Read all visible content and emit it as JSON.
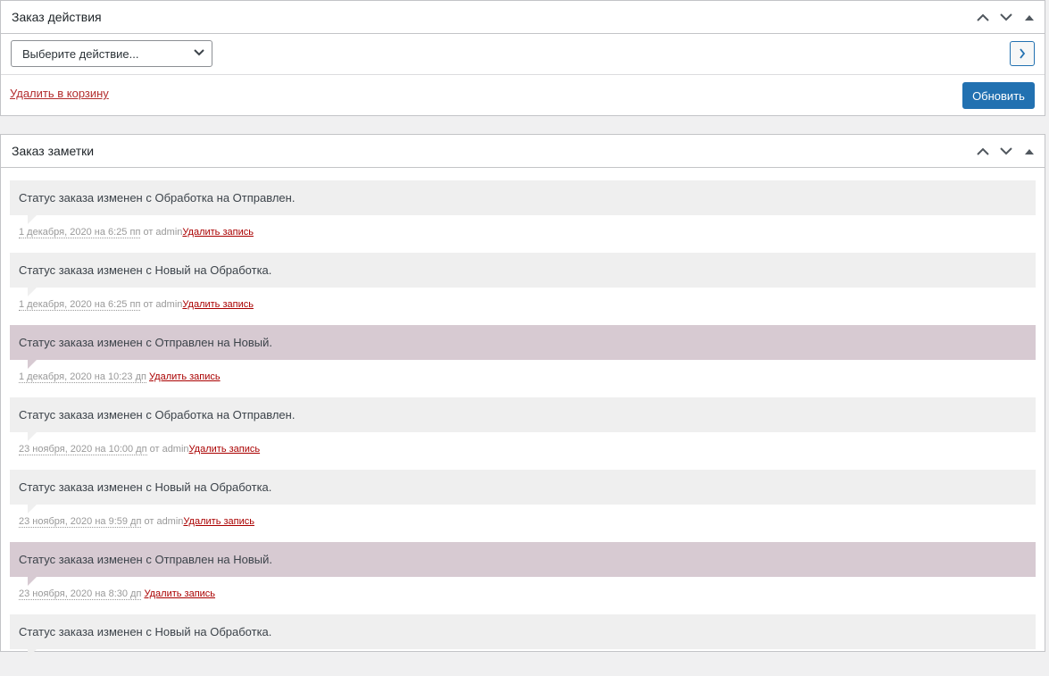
{
  "actions": {
    "title": "Заказ действия",
    "select_value": "Выберите действие...",
    "trash_label": "Удалить в корзину",
    "update_label": "Обновить"
  },
  "notes": {
    "title": "Заказ заметки",
    "items": [
      {
        "text": "Статус заказа изменен с Обработка на Отправлен.",
        "date": "1 декабря, 2020 на 6:25 пп",
        "by": " от admin",
        "delete": "Удалить запись",
        "customer": false
      },
      {
        "text": "Статус заказа изменен с Новый на Обработка.",
        "date": "1 декабря, 2020 на 6:25 пп",
        "by": " от admin",
        "delete": "Удалить запись",
        "customer": false
      },
      {
        "text": "Статус заказа изменен с Отправлен на Новый.",
        "date": "1 декабря, 2020 на 10:23 дп",
        "by": " ",
        "delete": "Удалить запись",
        "customer": true
      },
      {
        "text": "Статус заказа изменен с Обработка на Отправлен.",
        "date": "23 ноября, 2020 на 10:00 дп",
        "by": " от admin",
        "delete": "Удалить запись",
        "customer": false
      },
      {
        "text": "Статус заказа изменен с Новый на Обработка.",
        "date": "23 ноября, 2020 на 9:59 дп",
        "by": " от admin",
        "delete": "Удалить запись",
        "customer": false
      },
      {
        "text": "Статус заказа изменен с Отправлен на Новый.",
        "date": "23 ноября, 2020 на 8:30 дп",
        "by": " ",
        "delete": "Удалить запись",
        "customer": true
      },
      {
        "text": "Статус заказа изменен с Новый на Обработка.",
        "date": "",
        "by": "",
        "delete": "",
        "customer": false
      }
    ]
  }
}
